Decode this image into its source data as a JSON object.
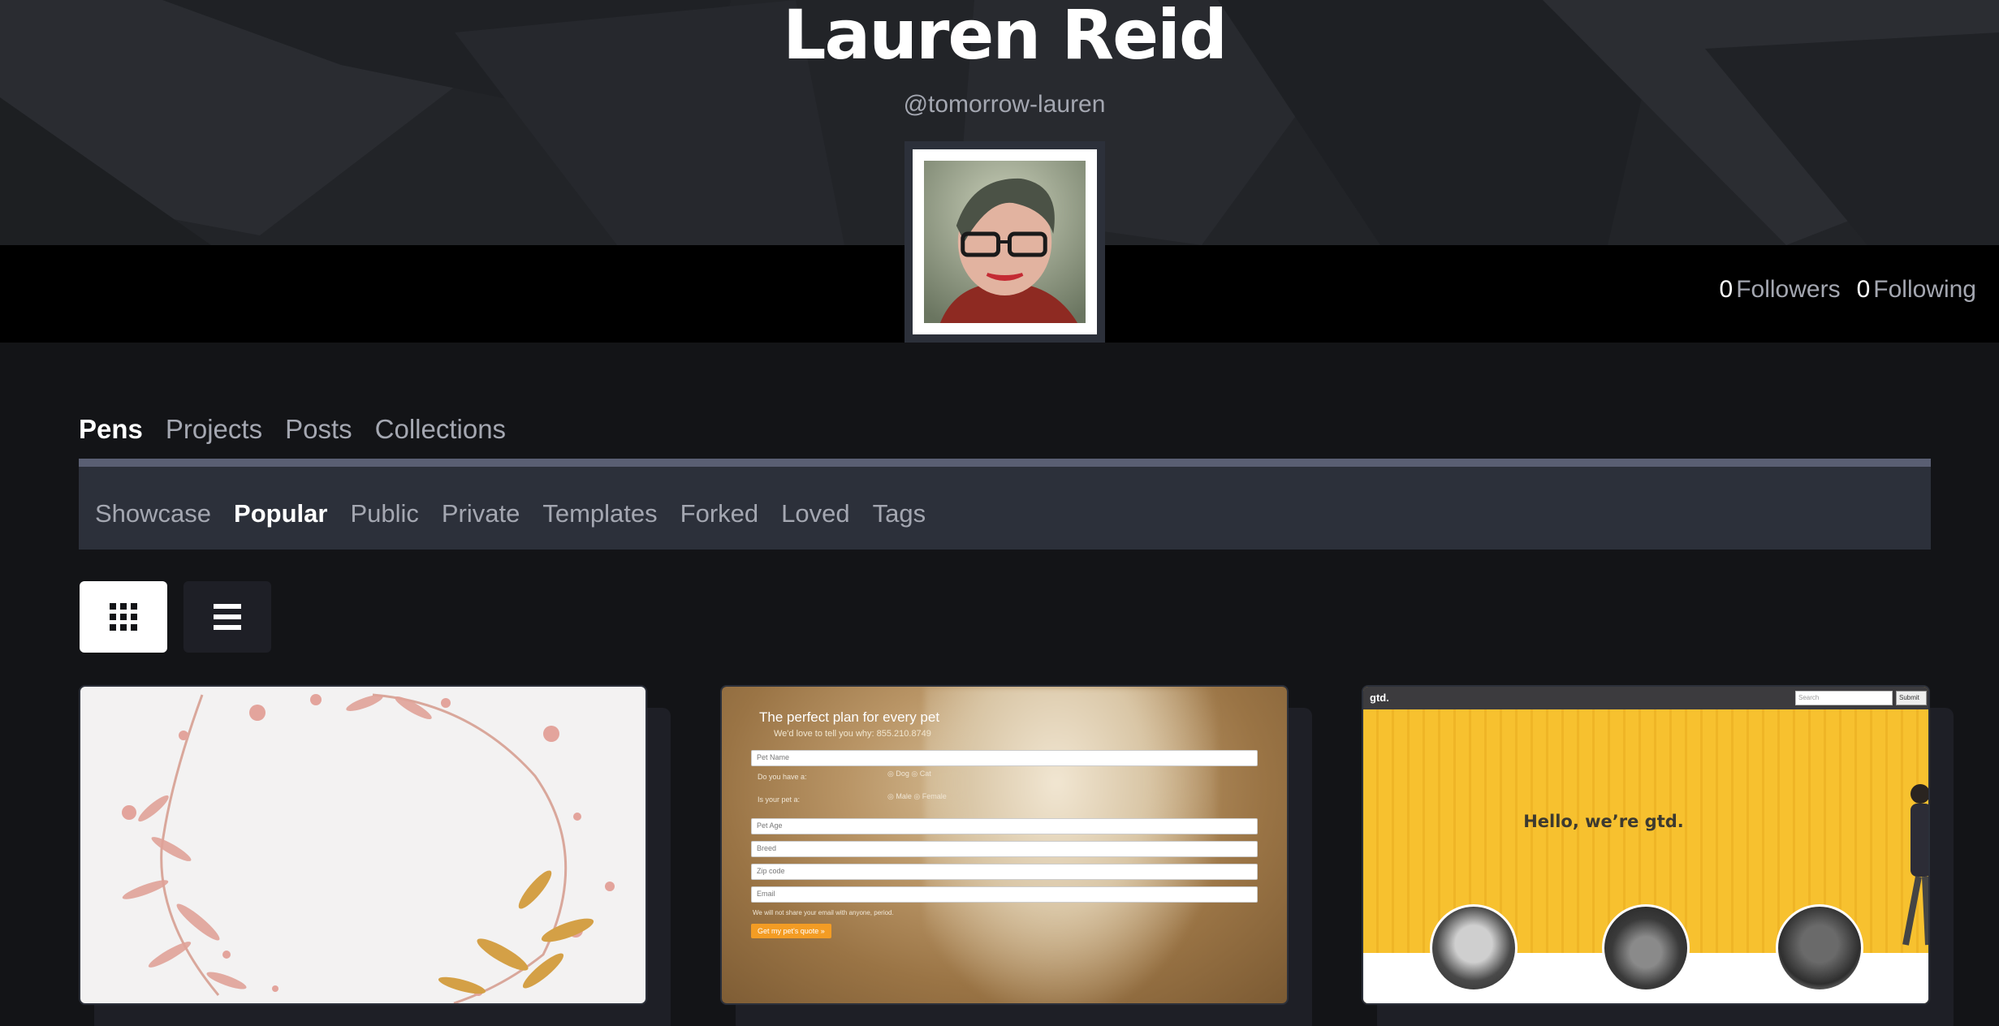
{
  "profile": {
    "name": "Lauren Reid",
    "handle": "@tomorrow-lauren",
    "followers_count": "0",
    "followers_label": "Followers",
    "following_count": "0",
    "following_label": "Following"
  },
  "main_tabs": [
    {
      "label": "Pens",
      "active": true
    },
    {
      "label": "Projects",
      "active": false
    },
    {
      "label": "Posts",
      "active": false
    },
    {
      "label": "Collections",
      "active": false
    }
  ],
  "sub_tabs": [
    {
      "label": "Showcase",
      "active": false
    },
    {
      "label": "Popular",
      "active": true
    },
    {
      "label": "Public",
      "active": false
    },
    {
      "label": "Private",
      "active": false
    },
    {
      "label": "Templates",
      "active": false
    },
    {
      "label": "Forked",
      "active": false
    },
    {
      "label": "Loved",
      "active": false
    },
    {
      "label": "Tags",
      "active": false
    }
  ],
  "view_toggle": {
    "grid_icon": "grid-icon",
    "list_icon": "list-icon",
    "selected": "grid"
  },
  "cards": {
    "pet": {
      "title": "The perfect plan for every pet",
      "subtitle": "We'd love to tell you why: 855.210.8749",
      "pet_name_placeholder": "Pet Name",
      "q1": "Do you have a:",
      "q1_opt1": "Dog",
      "q1_opt2": "Cat",
      "q2": "Is your pet a:",
      "q2_opt1": "Male",
      "q2_opt2": "Female",
      "pet_age": "Pet Age",
      "breed": "Breed",
      "zip": "Zip code",
      "email": "Email",
      "note": "We will not share your email with anyone, period.",
      "button": "Get my pet's quote »"
    },
    "gtd": {
      "logo": "gtd.",
      "search_placeholder": "Search",
      "submit": "Submit",
      "hero": "Hello, we’re gtd."
    }
  },
  "colors": {
    "background": "#131417",
    "panel": "#2c303a",
    "accent_orange": "#f39c24",
    "gtd_yellow": "#f7bf2e"
  }
}
